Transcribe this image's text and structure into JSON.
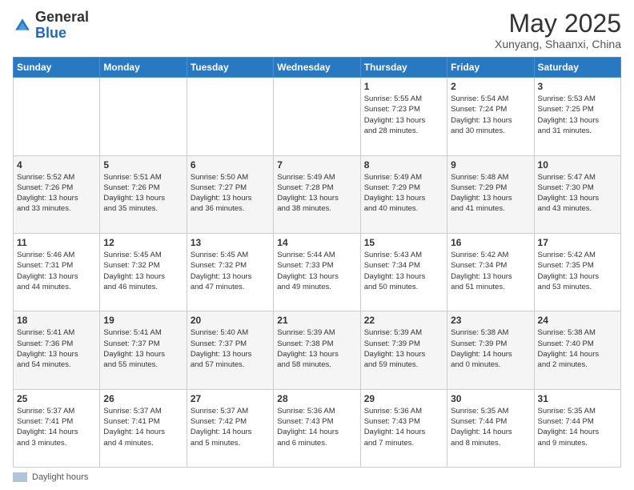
{
  "header": {
    "logo_general": "General",
    "logo_blue": "Blue",
    "month_title": "May 2025",
    "location": "Xunyang, Shaanxi, China"
  },
  "days_of_week": [
    "Sunday",
    "Monday",
    "Tuesday",
    "Wednesday",
    "Thursday",
    "Friday",
    "Saturday"
  ],
  "footer": {
    "legend_label": "Daylight hours"
  },
  "weeks": [
    [
      {
        "num": "",
        "info": ""
      },
      {
        "num": "",
        "info": ""
      },
      {
        "num": "",
        "info": ""
      },
      {
        "num": "",
        "info": ""
      },
      {
        "num": "1",
        "info": "Sunrise: 5:55 AM\nSunset: 7:23 PM\nDaylight: 13 hours\nand 28 minutes."
      },
      {
        "num": "2",
        "info": "Sunrise: 5:54 AM\nSunset: 7:24 PM\nDaylight: 13 hours\nand 30 minutes."
      },
      {
        "num": "3",
        "info": "Sunrise: 5:53 AM\nSunset: 7:25 PM\nDaylight: 13 hours\nand 31 minutes."
      }
    ],
    [
      {
        "num": "4",
        "info": "Sunrise: 5:52 AM\nSunset: 7:26 PM\nDaylight: 13 hours\nand 33 minutes."
      },
      {
        "num": "5",
        "info": "Sunrise: 5:51 AM\nSunset: 7:26 PM\nDaylight: 13 hours\nand 35 minutes."
      },
      {
        "num": "6",
        "info": "Sunrise: 5:50 AM\nSunset: 7:27 PM\nDaylight: 13 hours\nand 36 minutes."
      },
      {
        "num": "7",
        "info": "Sunrise: 5:49 AM\nSunset: 7:28 PM\nDaylight: 13 hours\nand 38 minutes."
      },
      {
        "num": "8",
        "info": "Sunrise: 5:49 AM\nSunset: 7:29 PM\nDaylight: 13 hours\nand 40 minutes."
      },
      {
        "num": "9",
        "info": "Sunrise: 5:48 AM\nSunset: 7:29 PM\nDaylight: 13 hours\nand 41 minutes."
      },
      {
        "num": "10",
        "info": "Sunrise: 5:47 AM\nSunset: 7:30 PM\nDaylight: 13 hours\nand 43 minutes."
      }
    ],
    [
      {
        "num": "11",
        "info": "Sunrise: 5:46 AM\nSunset: 7:31 PM\nDaylight: 13 hours\nand 44 minutes."
      },
      {
        "num": "12",
        "info": "Sunrise: 5:45 AM\nSunset: 7:32 PM\nDaylight: 13 hours\nand 46 minutes."
      },
      {
        "num": "13",
        "info": "Sunrise: 5:45 AM\nSunset: 7:32 PM\nDaylight: 13 hours\nand 47 minutes."
      },
      {
        "num": "14",
        "info": "Sunrise: 5:44 AM\nSunset: 7:33 PM\nDaylight: 13 hours\nand 49 minutes."
      },
      {
        "num": "15",
        "info": "Sunrise: 5:43 AM\nSunset: 7:34 PM\nDaylight: 13 hours\nand 50 minutes."
      },
      {
        "num": "16",
        "info": "Sunrise: 5:42 AM\nSunset: 7:34 PM\nDaylight: 13 hours\nand 51 minutes."
      },
      {
        "num": "17",
        "info": "Sunrise: 5:42 AM\nSunset: 7:35 PM\nDaylight: 13 hours\nand 53 minutes."
      }
    ],
    [
      {
        "num": "18",
        "info": "Sunrise: 5:41 AM\nSunset: 7:36 PM\nDaylight: 13 hours\nand 54 minutes."
      },
      {
        "num": "19",
        "info": "Sunrise: 5:41 AM\nSunset: 7:37 PM\nDaylight: 13 hours\nand 55 minutes."
      },
      {
        "num": "20",
        "info": "Sunrise: 5:40 AM\nSunset: 7:37 PM\nDaylight: 13 hours\nand 57 minutes."
      },
      {
        "num": "21",
        "info": "Sunrise: 5:39 AM\nSunset: 7:38 PM\nDaylight: 13 hours\nand 58 minutes."
      },
      {
        "num": "22",
        "info": "Sunrise: 5:39 AM\nSunset: 7:39 PM\nDaylight: 13 hours\nand 59 minutes."
      },
      {
        "num": "23",
        "info": "Sunrise: 5:38 AM\nSunset: 7:39 PM\nDaylight: 14 hours\nand 0 minutes."
      },
      {
        "num": "24",
        "info": "Sunrise: 5:38 AM\nSunset: 7:40 PM\nDaylight: 14 hours\nand 2 minutes."
      }
    ],
    [
      {
        "num": "25",
        "info": "Sunrise: 5:37 AM\nSunset: 7:41 PM\nDaylight: 14 hours\nand 3 minutes."
      },
      {
        "num": "26",
        "info": "Sunrise: 5:37 AM\nSunset: 7:41 PM\nDaylight: 14 hours\nand 4 minutes."
      },
      {
        "num": "27",
        "info": "Sunrise: 5:37 AM\nSunset: 7:42 PM\nDaylight: 14 hours\nand 5 minutes."
      },
      {
        "num": "28",
        "info": "Sunrise: 5:36 AM\nSunset: 7:43 PM\nDaylight: 14 hours\nand 6 minutes."
      },
      {
        "num": "29",
        "info": "Sunrise: 5:36 AM\nSunset: 7:43 PM\nDaylight: 14 hours\nand 7 minutes."
      },
      {
        "num": "30",
        "info": "Sunrise: 5:35 AM\nSunset: 7:44 PM\nDaylight: 14 hours\nand 8 minutes."
      },
      {
        "num": "31",
        "info": "Sunrise: 5:35 AM\nSunset: 7:44 PM\nDaylight: 14 hours\nand 9 minutes."
      }
    ]
  ]
}
